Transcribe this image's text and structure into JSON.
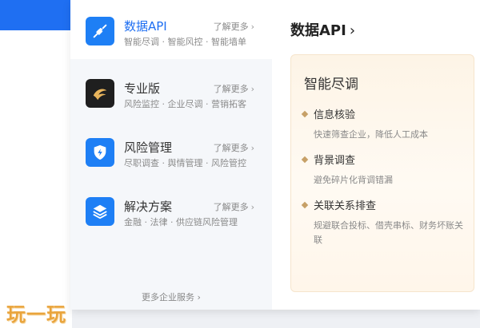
{
  "menu": {
    "items": [
      {
        "title": "数据API",
        "more": "了解更多",
        "sub": "智能尽调 · 智能风控 · 智能墙单",
        "icon": "plug-icon"
      },
      {
        "title": "专业版",
        "more": "了解更多",
        "sub": "风险监控 · 企业尽调 · 营销拓客",
        "icon": "eagle-logo-icon"
      },
      {
        "title": "风险管理",
        "more": "了解更多",
        "sub": "尽职调查 · 舆情管理 · 风险管控",
        "icon": "shield-icon"
      },
      {
        "title": "解决方案",
        "more": "了解更多",
        "sub": "金融 · 法律 · 供应链风险管理",
        "icon": "layers-icon"
      }
    ],
    "footer": "更多企业服务"
  },
  "detail": {
    "title": "数据API",
    "card_title": "智能尽调",
    "features": [
      {
        "name": "信息核验",
        "desc": "快速筛查企业，降低人工成本"
      },
      {
        "name": "背景调查",
        "desc": "避免碎片化背调错漏"
      },
      {
        "name": "关联关系排查",
        "desc": "规避联合投标、借壳串标、财务坏账关联"
      }
    ]
  },
  "watermark": "玩一玩",
  "colors": {
    "accent": "#1f6ff2",
    "icon_blue": "#1e7ff5",
    "gold": "#c7a067"
  }
}
